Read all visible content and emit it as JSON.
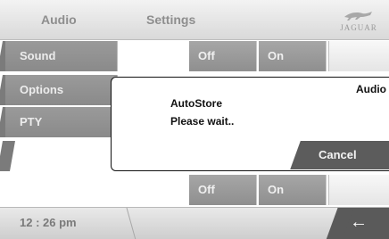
{
  "header": {
    "tab_audio": "Audio",
    "tab_settings": "Settings",
    "brand": "JAGUAR"
  },
  "menu": {
    "items": [
      {
        "label": "Sound"
      },
      {
        "label": "Options"
      },
      {
        "label": "PTY"
      }
    ]
  },
  "toggles": {
    "row1_off": "Off",
    "row1_on": "On",
    "row4_off": "Off",
    "row4_on": "On"
  },
  "dialog": {
    "title": "Audio",
    "line1": "AutoStore",
    "line2": "Please wait..",
    "cancel_label": "Cancel"
  },
  "footer": {
    "clock": "12 : 26 pm",
    "back_icon": "back-arrow-icon"
  },
  "colors": {
    "menu_gray": "#8f8f8f",
    "cancel_dark": "#5c5c5c",
    "footer_back": "#5a5a5a"
  }
}
